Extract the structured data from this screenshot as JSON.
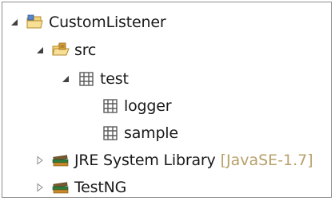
{
  "tree": {
    "project": {
      "label": "CustomListener",
      "icon": "java-project-icon",
      "expanded": true
    },
    "src": {
      "label": "src",
      "icon": "source-folder-icon",
      "expanded": true
    },
    "test": {
      "label": "test",
      "icon": "package-icon",
      "expanded": true
    },
    "logger": {
      "label": "logger",
      "icon": "package-icon"
    },
    "sample": {
      "label": "sample",
      "icon": "package-icon"
    },
    "jre": {
      "label": "JRE System Library",
      "decoration": "[JavaSE-1.7]",
      "icon": "library-icon",
      "expanded": false
    },
    "testng": {
      "label": "TestNG",
      "icon": "library-icon",
      "expanded": false
    }
  },
  "colors": {
    "decoration": "#b8a06a",
    "folder": "#e8b94a",
    "package": "#5a5a5a",
    "border": "#8c8c8c"
  }
}
